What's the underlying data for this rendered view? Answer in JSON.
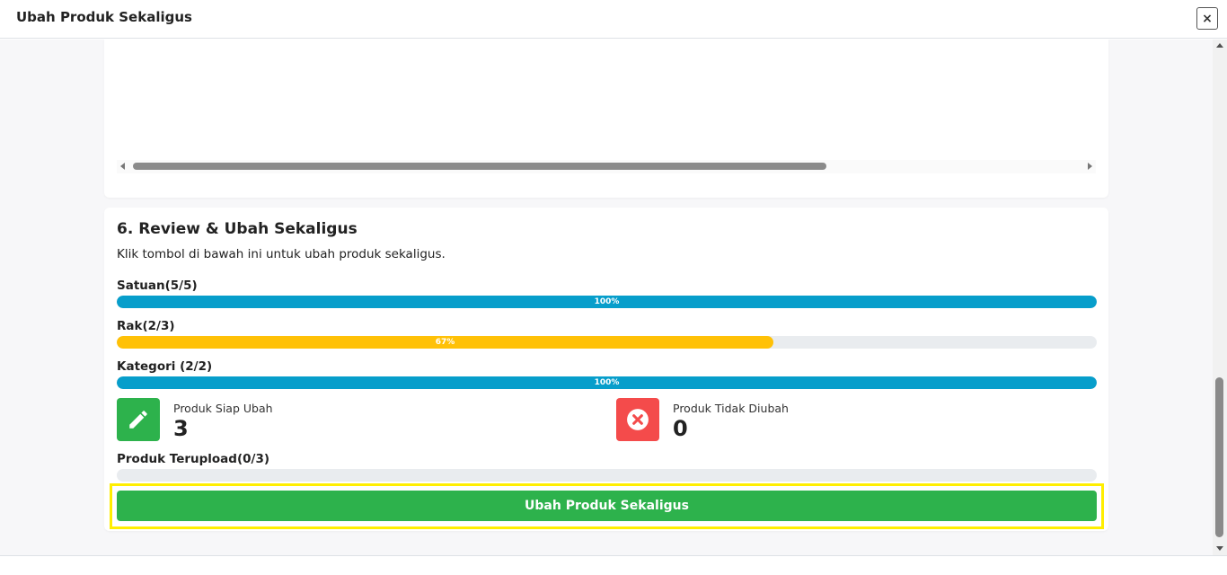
{
  "modal": {
    "title": "Ubah Produk Sekaligus",
    "close_label": "×"
  },
  "review": {
    "title": "6. Review & Ubah Sekaligus",
    "description": "Klik tombol di bawah ini untuk ubah produk sekaligus.",
    "progress": [
      {
        "label": "Satuan(5/5)",
        "percent": 100,
        "percent_text": "100%",
        "color": "#079ecb"
      },
      {
        "label": "Rak(2/3)",
        "percent": 67,
        "percent_text": "67%",
        "color": "#ffc107"
      },
      {
        "label": "Kategori (2/2)",
        "percent": 100,
        "percent_text": "100%",
        "color": "#079ecb"
      }
    ],
    "stats": [
      {
        "label": "Produk Siap Ubah",
        "value": "3",
        "icon": "pencil-icon",
        "color": "#2db24c"
      },
      {
        "label": "Produk Tidak Diubah",
        "value": "0",
        "icon": "x-circle-icon",
        "color": "#f44b4b"
      }
    ],
    "upload": {
      "label": "Produk Terupload(0/3)",
      "percent": 0
    },
    "action_label": "Ubah Produk Sekaligus"
  }
}
